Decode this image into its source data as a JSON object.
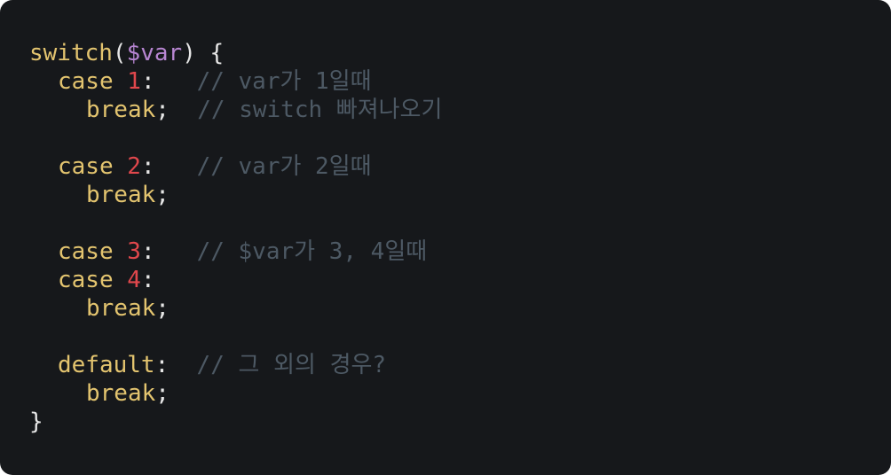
{
  "code": {
    "line1": {
      "kw": "switch",
      "open": "(",
      "var": "$var",
      "close": ") {"
    },
    "line2": {
      "kw": "case",
      "num": "1",
      "colon": ":",
      "comment": "// var가 1일때"
    },
    "line3": {
      "kw": "break",
      "semi": ";",
      "comment": "// switch 빠져나오기"
    },
    "line5": {
      "kw": "case",
      "num": "2",
      "colon": ":",
      "comment": "// var가 2일때"
    },
    "line6": {
      "kw": "break",
      "semi": ";"
    },
    "line8": {
      "kw": "case",
      "num": "3",
      "colon": ":",
      "comment": "// $var가 3, 4일때"
    },
    "line9": {
      "kw": "case",
      "num": "4",
      "colon": ":"
    },
    "line10": {
      "kw": "break",
      "semi": ";"
    },
    "line12": {
      "kw": "default",
      "colon": ":",
      "comment": "// 그 외의 경우?"
    },
    "line13": {
      "kw": "break",
      "semi": ";"
    },
    "line14": {
      "close": "}"
    }
  },
  "colors": {
    "background": "#16181b",
    "keyword": "#e3c46f",
    "variable": "#b785d1",
    "number": "#e0474c",
    "text": "#e6e6e6",
    "comment": "#4d5964"
  }
}
